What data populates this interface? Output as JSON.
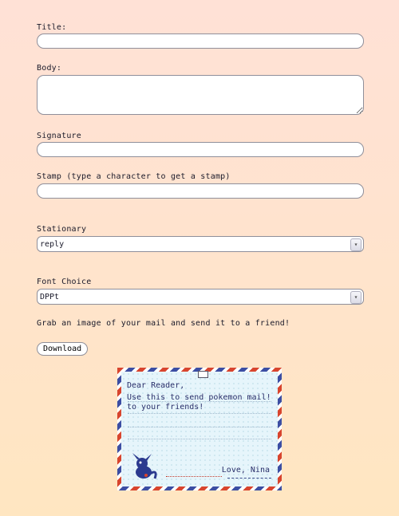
{
  "form": {
    "title_label": "Title:",
    "title_value": "",
    "body_label": "Body:",
    "body_value": "",
    "signature_label": "Signature",
    "signature_value": "",
    "stamp_label": "Stamp (type a character to get a stamp)",
    "stamp_value": "",
    "stationary_label": "Stationary",
    "stationary_value": "reply",
    "font_label": "Font Choice",
    "font_value": "DPPt"
  },
  "download": {
    "instruction": "Grab an image of your mail and send it to a friend!",
    "button_label": "Download"
  },
  "letter": {
    "line1": "Dear Reader,",
    "line2": "Use this to send pokemon mail!",
    "line3": "to your friends!",
    "signature": "Love, Nina"
  },
  "colors": {
    "stripe_red": "#d8452e",
    "stripe_blue": "#3c4ea3",
    "paper": "#e6f5fb"
  },
  "icons": {
    "envelope": "envelope-icon",
    "mascot": "pokemon-mascot-icon",
    "dropdown": "chevron-down-icon"
  }
}
